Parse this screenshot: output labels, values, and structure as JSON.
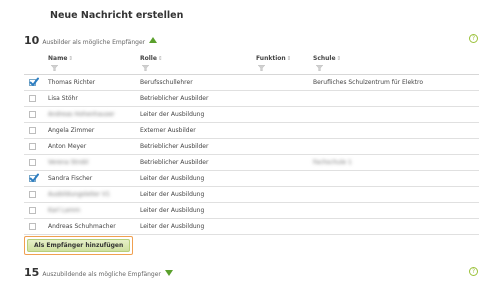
{
  "page_title": "Neue Nachricht erstellen",
  "section_trainers": {
    "count": "10",
    "label": "Ausbilder als mögliche Empfänger"
  },
  "section_students": {
    "count": "15",
    "label": "Auszubildende als mögliche Empfänger"
  },
  "help_glyph": "?",
  "columns": {
    "name": "Name",
    "rolle": "Rolle",
    "funktion": "Funktion",
    "schule": "Schule",
    "sort_glyph": "⇕"
  },
  "rows": [
    {
      "checked": true,
      "name": "Thomas Richter",
      "rolle": "Berufsschullehrer",
      "funktion": "",
      "schule": "Berufliches Schulzentrum für Elektro",
      "name_blurred": false,
      "schule_blurred": false
    },
    {
      "checked": false,
      "name": "Lisa Stöhr",
      "rolle": "Betrieblicher Ausbilder",
      "funktion": "",
      "schule": "",
      "name_blurred": false,
      "schule_blurred": false
    },
    {
      "checked": false,
      "name": "Andreas Hohenhauser",
      "rolle": "Leiter der Ausbildung",
      "funktion": "",
      "schule": "",
      "name_blurred": true,
      "schule_blurred": false
    },
    {
      "checked": false,
      "name": "Angela Zimmer",
      "rolle": "Externer Ausbilder",
      "funktion": "",
      "schule": "",
      "name_blurred": false,
      "schule_blurred": false
    },
    {
      "checked": false,
      "name": "Anton Meyer",
      "rolle": "Betrieblicher Ausbilder",
      "funktion": "",
      "schule": "",
      "name_blurred": false,
      "schule_blurred": false
    },
    {
      "checked": false,
      "name": "Verena Strobl",
      "rolle": "Betrieblicher Ausbilder",
      "funktion": "",
      "schule": "Fachschule 1",
      "name_blurred": true,
      "schule_blurred": true
    },
    {
      "checked": true,
      "name": "Sandra Fischer",
      "rolle": "Leiter der Ausbildung",
      "funktion": "",
      "schule": "",
      "name_blurred": false,
      "schule_blurred": false
    },
    {
      "checked": false,
      "name": "Ausbildungsleiter V1",
      "rolle": "Leiter der Ausbildung",
      "funktion": "",
      "schule": "",
      "name_blurred": true,
      "schule_blurred": false
    },
    {
      "checked": false,
      "name": "Karl Lamm",
      "rolle": "Leiter der Ausbildung",
      "funktion": "",
      "schule": "",
      "name_blurred": true,
      "schule_blurred": false
    },
    {
      "checked": false,
      "name": "Andreas Schuhmacher",
      "rolle": "Leiter der Ausbildung",
      "funktion": "",
      "schule": "",
      "name_blurred": false,
      "schule_blurred": false
    }
  ],
  "add_button_label": "Als Empfänger hinzufügen",
  "colors": {
    "accent_green": "#5aa02c",
    "button_outline": "#f0a050",
    "check_blue": "#2e7ec2"
  },
  "icons": [
    "filter-icon",
    "sort-icon",
    "help-icon",
    "collapse-arrow-icon",
    "expand-arrow-icon",
    "checkmark-icon"
  ]
}
